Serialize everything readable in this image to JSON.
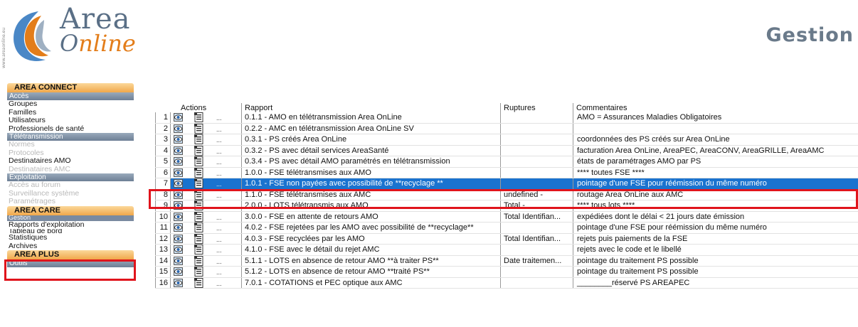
{
  "header": {
    "logo_vertical_text": "www.areaonline.eu",
    "logo_area": "Area",
    "logo_online_o": "O",
    "logo_online_rest": "nline",
    "page_title": "Gestion"
  },
  "sidebar": {
    "area_connect": "AREA CONNECT",
    "acces": {
      "header": "Accès",
      "items": [
        "Groupes",
        "Familles",
        "Utilisateurs",
        "Professionels de santé"
      ]
    },
    "teletransmission": {
      "header": "Télétransmission",
      "items": [
        "Normes",
        "Protocoles",
        "Destinataires AMO",
        "Destinataires AMC"
      ]
    },
    "exploitation": {
      "header": "Exploitation",
      "items": [
        "Accès au forum",
        "Surveillance système",
        "Paramétrages"
      ]
    },
    "area_care": "AREA CARE",
    "care_items": [
      "Gestion",
      "Rapports d'exploitation",
      "Tableau de bord",
      "Statistiques",
      "Archives"
    ],
    "area_plus": "AREA PLUS",
    "plus_items": [
      "Outils"
    ]
  },
  "table": {
    "columns": {
      "actions": "Actions",
      "rapport": "Rapport",
      "ruptures": "Ruptures",
      "commentaires": "Commentaires"
    },
    "ellipsis": "...",
    "selected_row": 7,
    "rows": [
      {
        "num": "1",
        "rapport": "0.1.1 - AMO en télétransmission Area OnLine",
        "ruptures": "",
        "commentaire": "AMO = Assurances Maladies Obligatoires"
      },
      {
        "num": "2",
        "rapport": "0.2.2 - AMC en télétransmission Area OnLine SV",
        "ruptures": "",
        "commentaire": ""
      },
      {
        "num": "3",
        "rapport": "0.3.1 - PS créés Area OnLine",
        "ruptures": "",
        "commentaire": "coordonnées des PS créés sur Area OnLine"
      },
      {
        "num": "4",
        "rapport": "0.3.2 - PS avec détail services AreaSanté",
        "ruptures": "",
        "commentaire": "facturation Area OnLine, AreaPEC, AreaCONV, AreaGRILLE, AreaAMC"
      },
      {
        "num": "5",
        "rapport": "0.3.4 - PS avec détail AMO paramétrés en télétransmission",
        "ruptures": "",
        "commentaire": "états de paramétrages AMO par PS"
      },
      {
        "num": "6",
        "rapport": "1.0.0 - FSE télétransmises aux AMO",
        "ruptures": "",
        "commentaire": "**** toutes FSE ****"
      },
      {
        "num": "7",
        "rapport": "1.0.1 - FSE non payées avec possibilité de **recyclage **",
        "ruptures": "",
        "commentaire": "pointage d'une FSE pour réémission du même numéro"
      },
      {
        "num": "8",
        "rapport": "1.1.0 - FSE télétransmises aux AMC",
        "ruptures": "undefined -",
        "commentaire": "routage Area OnLine aux AMC"
      },
      {
        "num": "9",
        "rapport": "2.0.0 - LOTS télétransmis aux AMO",
        "ruptures": "Total -",
        "commentaire": "**** tous lots ****"
      },
      {
        "num": "10",
        "rapport": "3.0.0 - FSE en attente de retours AMO",
        "ruptures": "Total Identifian...",
        "commentaire": "expédiées dont le délai < 21 jours date émission"
      },
      {
        "num": "11",
        "rapport": "4.0.2 - FSE rejetées par les AMO avec possibilité de **recyclage**",
        "ruptures": "",
        "commentaire": "pointage d'une FSE pour réémission du même numéro"
      },
      {
        "num": "12",
        "rapport": "4.0.3 - FSE recyclées par les AMO",
        "ruptures": "Total Identifian...",
        "commentaire": "rejets puis paiements de la FSE"
      },
      {
        "num": "13",
        "rapport": "4.1.0 - FSE avec le détail du rejet AMC",
        "ruptures": "",
        "commentaire": "rejets avec le code et le libellé"
      },
      {
        "num": "14",
        "rapport": "5.1.1 - LOTS en absence de retour AMO **à traiter PS**",
        "ruptures": "Date traitemen...",
        "commentaire": "pointage du traitement PS possible"
      },
      {
        "num": "15",
        "rapport": "5.1.2 - LOTS en absence de retour AMO **traité PS**",
        "ruptures": "",
        "commentaire": "pointage du traitement PS possible"
      },
      {
        "num": "16",
        "rapport": "7.0.1 - COTATIONS et PEC optique aux AMC",
        "ruptures": "",
        "commentaire": "________réservé PS AREAPEC"
      }
    ]
  },
  "colors": {
    "selection": "#1a73cf",
    "highlight_box": "#e0141c",
    "section_orange": "#f0a74a",
    "brand_orange": "#e37d1a",
    "brand_grey": "#5a6f86"
  }
}
